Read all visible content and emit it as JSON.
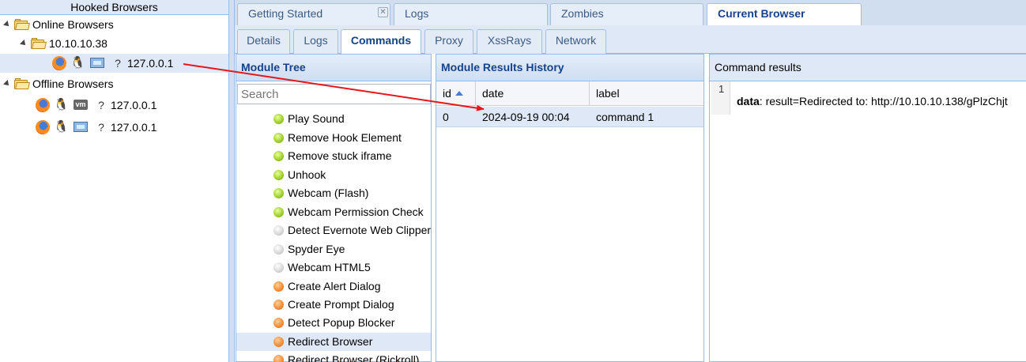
{
  "left_panel": {
    "title": "Hooked Browsers",
    "online_label": "Online Browsers",
    "online_group": "10.10.10.38",
    "online_browsers": [
      {
        "ip": "127.0.0.1",
        "browser_icon": "firefox-icon",
        "os_icon": "linux-tux-icon",
        "hw_icon": "computer-icon",
        "extra_icon": "question-icon"
      }
    ],
    "offline_label": "Offline Browsers",
    "offline_browsers": [
      {
        "ip": "127.0.0.1",
        "browser_icon": "firefox-icon",
        "os_icon": "linux-tux-icon",
        "hw_icon": "vmware-icon",
        "extra_icon": "question-icon"
      },
      {
        "ip": "127.0.0.1",
        "browser_icon": "firefox-icon",
        "os_icon": "linux-tux-icon",
        "hw_icon": "computer-icon",
        "extra_icon": "question-icon"
      }
    ]
  },
  "main_tabs": [
    {
      "label": "Getting Started",
      "closable": true
    },
    {
      "label": "Logs"
    },
    {
      "label": "Zombies"
    },
    {
      "label": "Current Browser",
      "active": true
    }
  ],
  "sub_tabs": [
    {
      "label": "Details"
    },
    {
      "label": "Logs"
    },
    {
      "label": "Commands",
      "active": true
    },
    {
      "label": "Proxy"
    },
    {
      "label": "XssRays"
    },
    {
      "label": "Network"
    }
  ],
  "module_tree": {
    "title": "Module Tree",
    "search_placeholder": "Search",
    "modules": [
      {
        "label": "Play Sound",
        "status": "green"
      },
      {
        "label": "Remove Hook Element",
        "status": "green"
      },
      {
        "label": "Remove stuck iframe",
        "status": "green"
      },
      {
        "label": "Unhook",
        "status": "green"
      },
      {
        "label": "Webcam (Flash)",
        "status": "green"
      },
      {
        "label": "Webcam Permission Check",
        "status": "green"
      },
      {
        "label": "Detect Evernote Web Clipper",
        "status": "grey"
      },
      {
        "label": "Spyder Eye",
        "status": "grey"
      },
      {
        "label": "Webcam HTML5",
        "status": "grey"
      },
      {
        "label": "Create Alert Dialog",
        "status": "orange"
      },
      {
        "label": "Create Prompt Dialog",
        "status": "orange"
      },
      {
        "label": "Detect Popup Blocker",
        "status": "orange"
      },
      {
        "label": "Redirect Browser",
        "status": "orange",
        "selected": true
      },
      {
        "label": "Redirect Browser (Rickroll)",
        "status": "orange"
      }
    ]
  },
  "results_history": {
    "title": "Module Results History",
    "columns": [
      "id",
      "date",
      "label"
    ],
    "rows": [
      {
        "id": "0",
        "date": "2024-09-19 00:04",
        "label": "command 1"
      }
    ]
  },
  "command_results": {
    "title": "Command results",
    "line_number": "1",
    "key": "data",
    "value": ": result=Redirected to: http://10.10.10.138/gPlzChjt"
  },
  "colors": {
    "accent": "#15428b",
    "header_bg": "#dfe8f6",
    "border": "#99bbe8",
    "annotation_arrow": "#e8161a"
  }
}
